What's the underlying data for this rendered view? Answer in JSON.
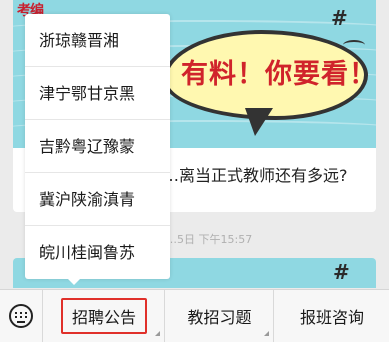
{
  "card": {
    "logo_text": "考编",
    "bubble_text": "有料！你要看！",
    "title": "…离当正式教师还有多远?",
    "timestamp": "…5日 下午15:57"
  },
  "popup": {
    "items": [
      {
        "label": "浙琼赣晋湘"
      },
      {
        "label": "津宁鄂甘京黑"
      },
      {
        "label": "吉黔粤辽豫蒙"
      },
      {
        "label": "冀沪陕渝滇青"
      },
      {
        "label": "皖川桂闽鲁苏"
      }
    ]
  },
  "menubar": {
    "keyboard_icon": "keyboard-icon",
    "tabs": [
      {
        "label": "招聘公告",
        "active": true
      },
      {
        "label": "教招习题"
      },
      {
        "label": "报班咨询"
      }
    ],
    "accent_color": "#e0302a"
  }
}
